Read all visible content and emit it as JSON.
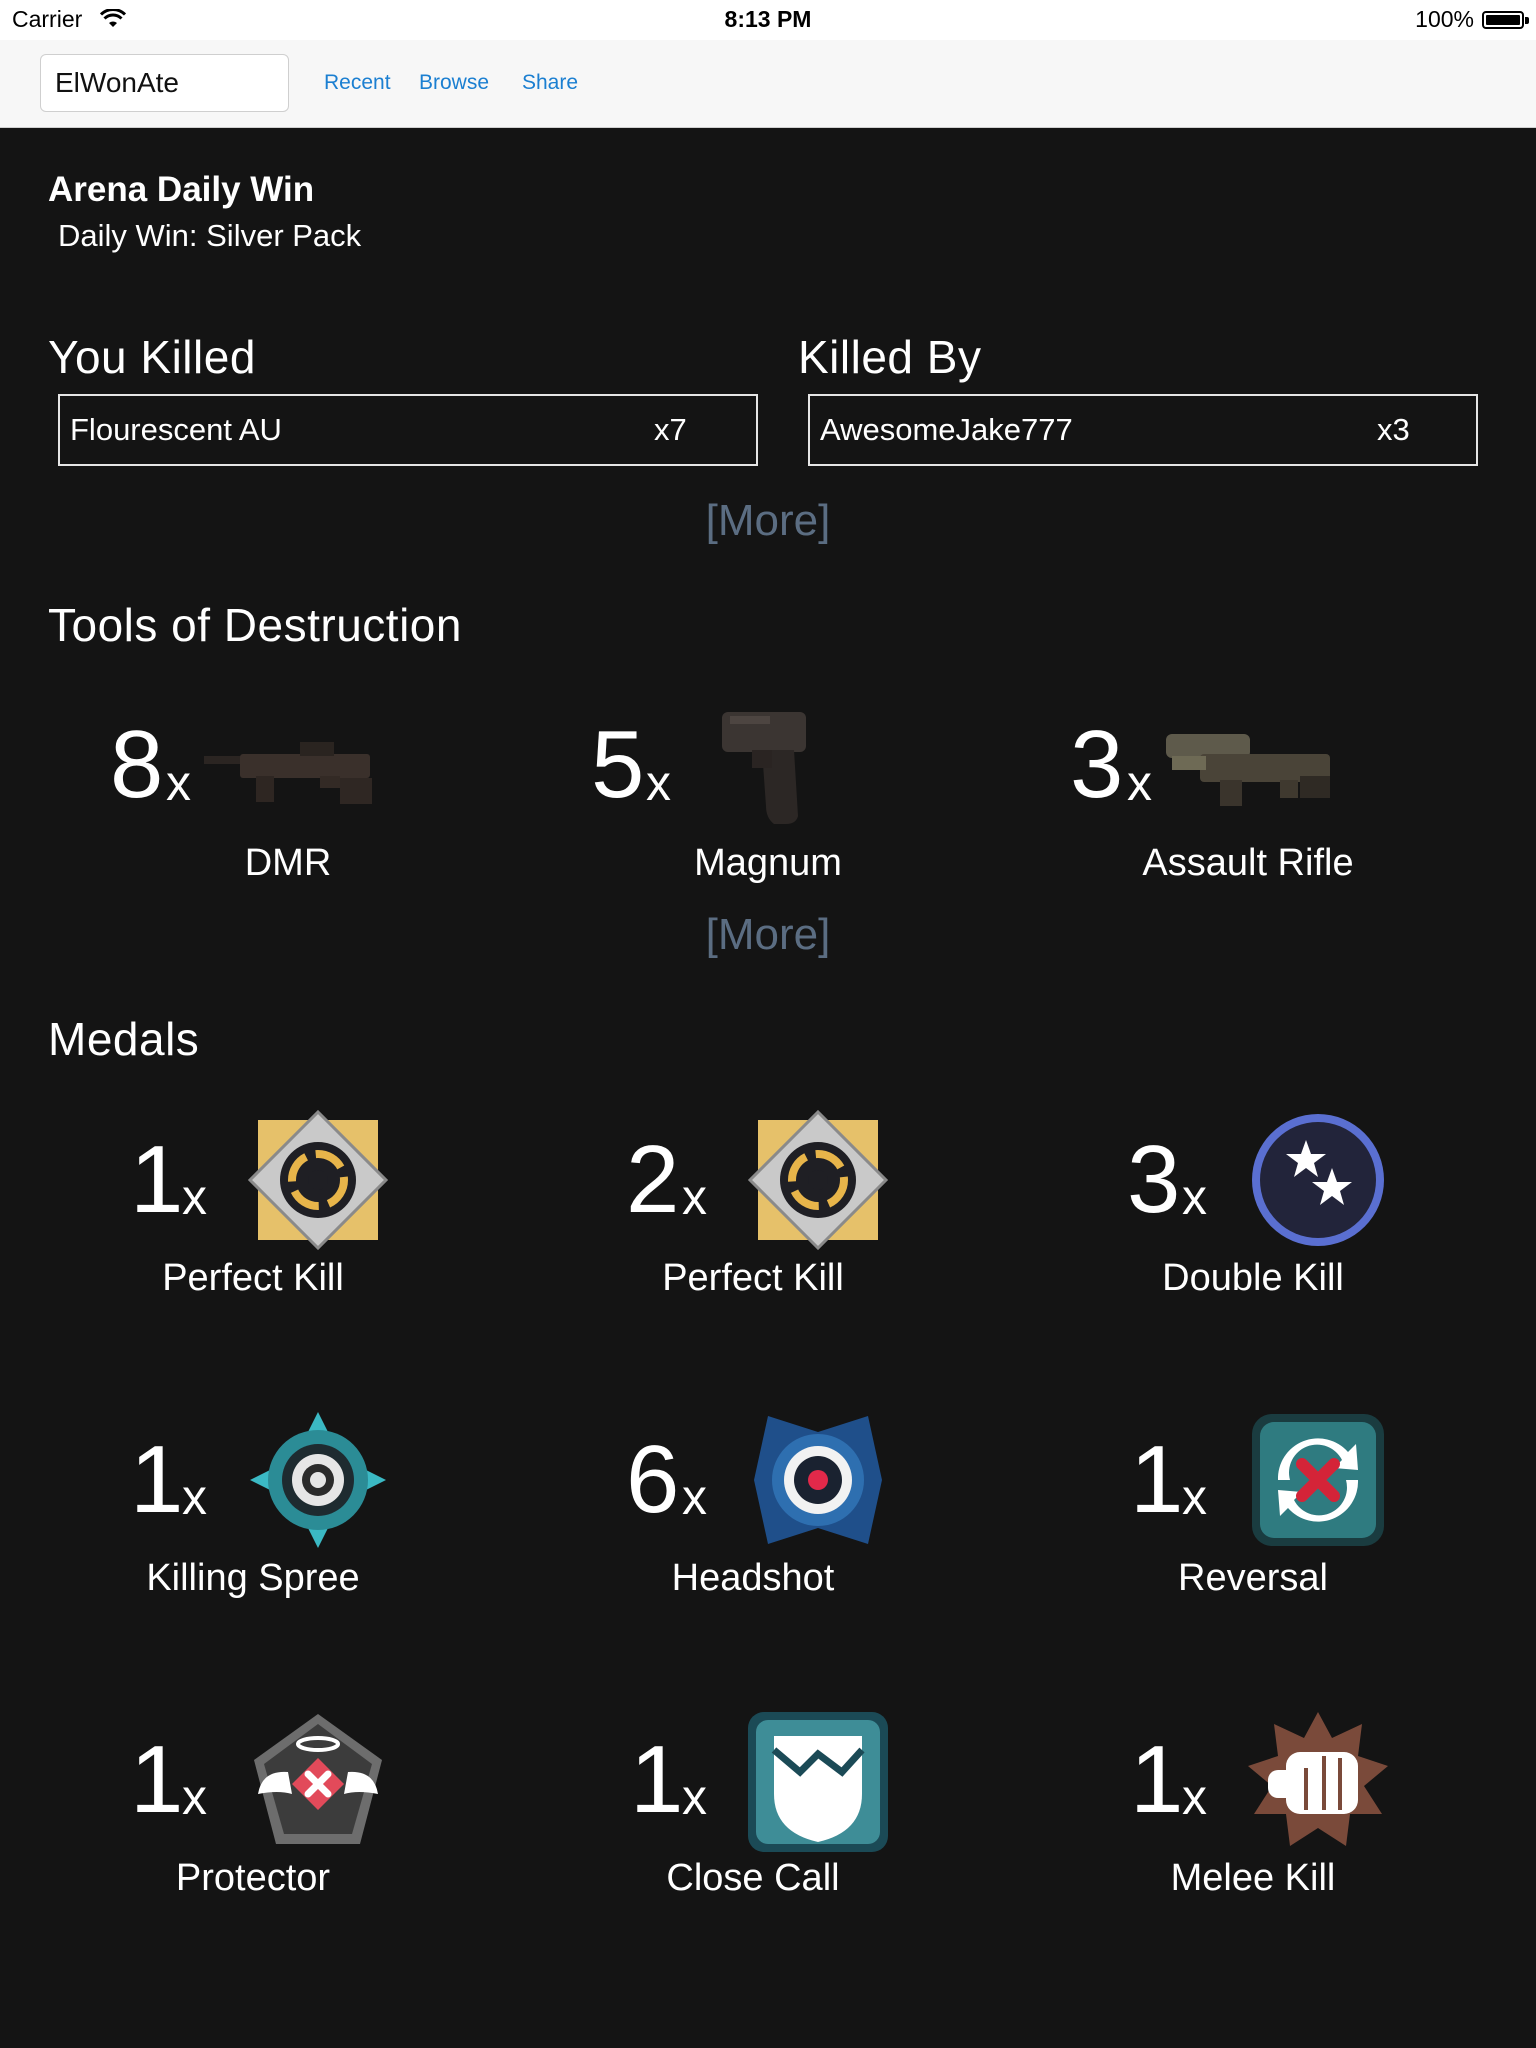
{
  "status_bar": {
    "carrier": "Carrier",
    "time": "8:13 PM",
    "battery": "100%"
  },
  "nav": {
    "search_value": "ElWonAte",
    "links": [
      "Recent",
      "Browse",
      "Share"
    ]
  },
  "event": {
    "title": "Arena Daily Win",
    "subtitle": "Daily Win: Silver Pack"
  },
  "you_killed": {
    "heading": "You Killed",
    "name": "Flourescent AU",
    "count": "x7"
  },
  "killed_by": {
    "heading": "Killed By",
    "name": "AwesomeJake777",
    "count": "x3"
  },
  "more_label": "[More]",
  "tools": {
    "heading": "Tools of Destruction",
    "items": [
      {
        "count": "8",
        "suffix": "x",
        "name": "DMR",
        "icon": "dmr-weapon-icon"
      },
      {
        "count": "5",
        "suffix": "x",
        "name": "Magnum",
        "icon": "magnum-weapon-icon"
      },
      {
        "count": "3",
        "suffix": "x",
        "name": "Assault Rifle",
        "icon": "assault-rifle-weapon-icon"
      }
    ]
  },
  "medals": {
    "heading": "Medals",
    "items": [
      {
        "count": "1",
        "suffix": "x",
        "name": "Perfect Kill",
        "icon": "perfect-kill-medal-icon"
      },
      {
        "count": "2",
        "suffix": "x",
        "name": "Perfect Kill",
        "icon": "perfect-kill-medal-icon"
      },
      {
        "count": "3",
        "suffix": "x",
        "name": "Double Kill",
        "icon": "double-kill-medal-icon"
      },
      {
        "count": "1",
        "suffix": "x",
        "name": "Killing Spree",
        "icon": "killing-spree-medal-icon"
      },
      {
        "count": "6",
        "suffix": "x",
        "name": "Headshot",
        "icon": "headshot-medal-icon"
      },
      {
        "count": "1",
        "suffix": "x",
        "name": "Reversal",
        "icon": "reversal-medal-icon"
      },
      {
        "count": "1",
        "suffix": "x",
        "name": "Protector",
        "icon": "protector-medal-icon"
      },
      {
        "count": "1",
        "suffix": "x",
        "name": "Close Call",
        "icon": "close-call-medal-icon"
      },
      {
        "count": "1",
        "suffix": "x",
        "name": "Melee Kill",
        "icon": "melee-kill-medal-icon"
      }
    ]
  }
}
